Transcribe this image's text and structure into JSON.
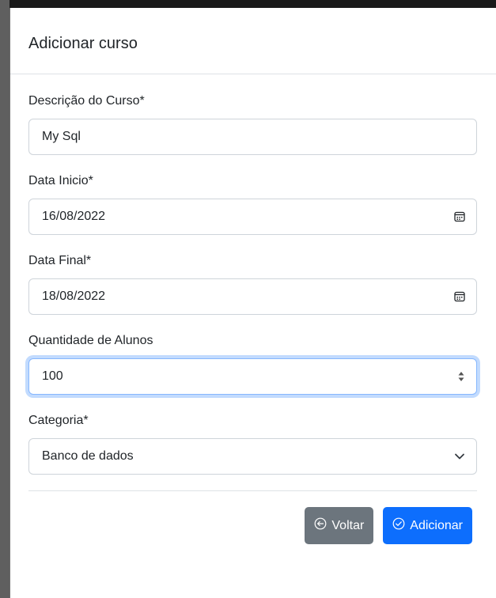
{
  "modal": {
    "title": "Adicionar curso"
  },
  "form": {
    "description": {
      "label": "Descrição do Curso*",
      "value": "My Sql"
    },
    "start_date": {
      "label": "Data Inicio*",
      "value": "16/08/2022",
      "icon": "calendar-icon"
    },
    "end_date": {
      "label": "Data Final*",
      "value": "18/08/2022",
      "icon": "calendar-icon"
    },
    "students": {
      "label": "Quantidade de Alunos",
      "value": "100",
      "icon": "spinner-icon"
    },
    "category": {
      "label": "Categoria*",
      "value": "Banco de dados",
      "icon": "chevron-down-icon"
    }
  },
  "footer": {
    "back_label": "Voltar",
    "back_icon": "arrow-left-circle-icon",
    "add_label": "Adicionar",
    "add_icon": "check-circle-icon"
  },
  "colors": {
    "primary": "#0d6efd",
    "secondary": "#6c757d",
    "focus_ring": "#86b7fe"
  }
}
